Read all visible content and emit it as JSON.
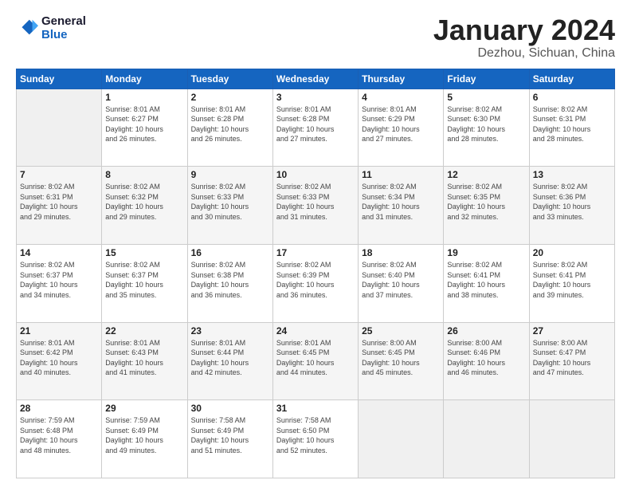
{
  "header": {
    "logo_line1": "General",
    "logo_line2": "Blue",
    "month": "January 2024",
    "location": "Dezhou, Sichuan, China"
  },
  "days_of_week": [
    "Sunday",
    "Monday",
    "Tuesday",
    "Wednesday",
    "Thursday",
    "Friday",
    "Saturday"
  ],
  "weeks": [
    [
      {
        "day": "",
        "info": ""
      },
      {
        "day": "1",
        "info": "Sunrise: 8:01 AM\nSunset: 6:27 PM\nDaylight: 10 hours\nand 26 minutes."
      },
      {
        "day": "2",
        "info": "Sunrise: 8:01 AM\nSunset: 6:28 PM\nDaylight: 10 hours\nand 26 minutes."
      },
      {
        "day": "3",
        "info": "Sunrise: 8:01 AM\nSunset: 6:28 PM\nDaylight: 10 hours\nand 27 minutes."
      },
      {
        "day": "4",
        "info": "Sunrise: 8:01 AM\nSunset: 6:29 PM\nDaylight: 10 hours\nand 27 minutes."
      },
      {
        "day": "5",
        "info": "Sunrise: 8:02 AM\nSunset: 6:30 PM\nDaylight: 10 hours\nand 28 minutes."
      },
      {
        "day": "6",
        "info": "Sunrise: 8:02 AM\nSunset: 6:31 PM\nDaylight: 10 hours\nand 28 minutes."
      }
    ],
    [
      {
        "day": "7",
        "info": "Sunrise: 8:02 AM\nSunset: 6:31 PM\nDaylight: 10 hours\nand 29 minutes."
      },
      {
        "day": "8",
        "info": "Sunrise: 8:02 AM\nSunset: 6:32 PM\nDaylight: 10 hours\nand 29 minutes."
      },
      {
        "day": "9",
        "info": "Sunrise: 8:02 AM\nSunset: 6:33 PM\nDaylight: 10 hours\nand 30 minutes."
      },
      {
        "day": "10",
        "info": "Sunrise: 8:02 AM\nSunset: 6:33 PM\nDaylight: 10 hours\nand 31 minutes."
      },
      {
        "day": "11",
        "info": "Sunrise: 8:02 AM\nSunset: 6:34 PM\nDaylight: 10 hours\nand 31 minutes."
      },
      {
        "day": "12",
        "info": "Sunrise: 8:02 AM\nSunset: 6:35 PM\nDaylight: 10 hours\nand 32 minutes."
      },
      {
        "day": "13",
        "info": "Sunrise: 8:02 AM\nSunset: 6:36 PM\nDaylight: 10 hours\nand 33 minutes."
      }
    ],
    [
      {
        "day": "14",
        "info": "Sunrise: 8:02 AM\nSunset: 6:37 PM\nDaylight: 10 hours\nand 34 minutes."
      },
      {
        "day": "15",
        "info": "Sunrise: 8:02 AM\nSunset: 6:37 PM\nDaylight: 10 hours\nand 35 minutes."
      },
      {
        "day": "16",
        "info": "Sunrise: 8:02 AM\nSunset: 6:38 PM\nDaylight: 10 hours\nand 36 minutes."
      },
      {
        "day": "17",
        "info": "Sunrise: 8:02 AM\nSunset: 6:39 PM\nDaylight: 10 hours\nand 36 minutes."
      },
      {
        "day": "18",
        "info": "Sunrise: 8:02 AM\nSunset: 6:40 PM\nDaylight: 10 hours\nand 37 minutes."
      },
      {
        "day": "19",
        "info": "Sunrise: 8:02 AM\nSunset: 6:41 PM\nDaylight: 10 hours\nand 38 minutes."
      },
      {
        "day": "20",
        "info": "Sunrise: 8:02 AM\nSunset: 6:41 PM\nDaylight: 10 hours\nand 39 minutes."
      }
    ],
    [
      {
        "day": "21",
        "info": "Sunrise: 8:01 AM\nSunset: 6:42 PM\nDaylight: 10 hours\nand 40 minutes."
      },
      {
        "day": "22",
        "info": "Sunrise: 8:01 AM\nSunset: 6:43 PM\nDaylight: 10 hours\nand 41 minutes."
      },
      {
        "day": "23",
        "info": "Sunrise: 8:01 AM\nSunset: 6:44 PM\nDaylight: 10 hours\nand 42 minutes."
      },
      {
        "day": "24",
        "info": "Sunrise: 8:01 AM\nSunset: 6:45 PM\nDaylight: 10 hours\nand 44 minutes."
      },
      {
        "day": "25",
        "info": "Sunrise: 8:00 AM\nSunset: 6:45 PM\nDaylight: 10 hours\nand 45 minutes."
      },
      {
        "day": "26",
        "info": "Sunrise: 8:00 AM\nSunset: 6:46 PM\nDaylight: 10 hours\nand 46 minutes."
      },
      {
        "day": "27",
        "info": "Sunrise: 8:00 AM\nSunset: 6:47 PM\nDaylight: 10 hours\nand 47 minutes."
      }
    ],
    [
      {
        "day": "28",
        "info": "Sunrise: 7:59 AM\nSunset: 6:48 PM\nDaylight: 10 hours\nand 48 minutes."
      },
      {
        "day": "29",
        "info": "Sunrise: 7:59 AM\nSunset: 6:49 PM\nDaylight: 10 hours\nand 49 minutes."
      },
      {
        "day": "30",
        "info": "Sunrise: 7:58 AM\nSunset: 6:49 PM\nDaylight: 10 hours\nand 51 minutes."
      },
      {
        "day": "31",
        "info": "Sunrise: 7:58 AM\nSunset: 6:50 PM\nDaylight: 10 hours\nand 52 minutes."
      },
      {
        "day": "",
        "info": ""
      },
      {
        "day": "",
        "info": ""
      },
      {
        "day": "",
        "info": ""
      }
    ]
  ]
}
